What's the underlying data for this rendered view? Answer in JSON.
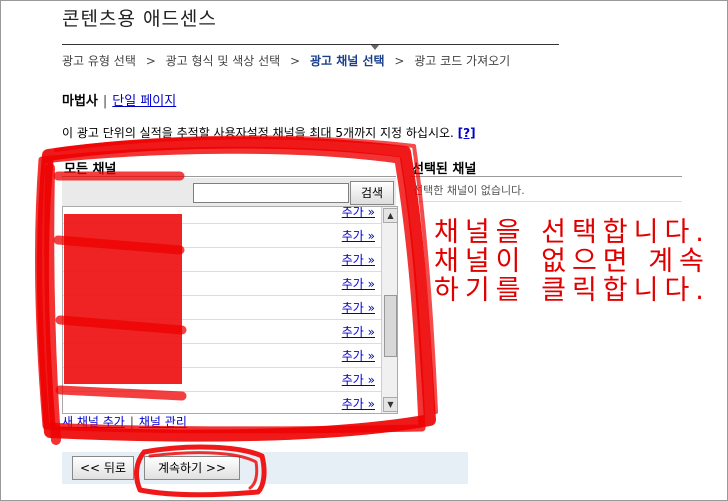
{
  "page": {
    "title": "콘텐츠용 애드센스"
  },
  "breadcrumb": {
    "steps": [
      "광고 유형 선택",
      "광고 형식 및 색상 선택",
      "광고 채널 선택",
      "광고 코드 가져오기"
    ],
    "separator": ">"
  },
  "owner": {
    "name": "마법사",
    "separator": "|",
    "page_link": "단일 페이지"
  },
  "description": {
    "text": "이 광고 단위의 실적을 추적할 사용자설정 채널을 최대 5개까지 지정 하십시오.",
    "help": "[?]"
  },
  "all_channels": {
    "header": "모든 채널",
    "search_button": "검색",
    "search_value": "",
    "add_label": "추가 »"
  },
  "selected_channels": {
    "header": "선택된 채널",
    "empty": "선택한 채널이 없습니다."
  },
  "footer_links": {
    "new_channel": "새 채널 추가",
    "manage": "채널 관리",
    "separator": "|"
  },
  "buttons": {
    "back": "<< 뒤로",
    "continue": "계속하기 >>"
  },
  "annotation": {
    "lines": [
      "채널을 선택합니다.",
      "채널이 없으면 계속",
      "하기를 클릭합니다."
    ],
    "color": "#e00000"
  }
}
